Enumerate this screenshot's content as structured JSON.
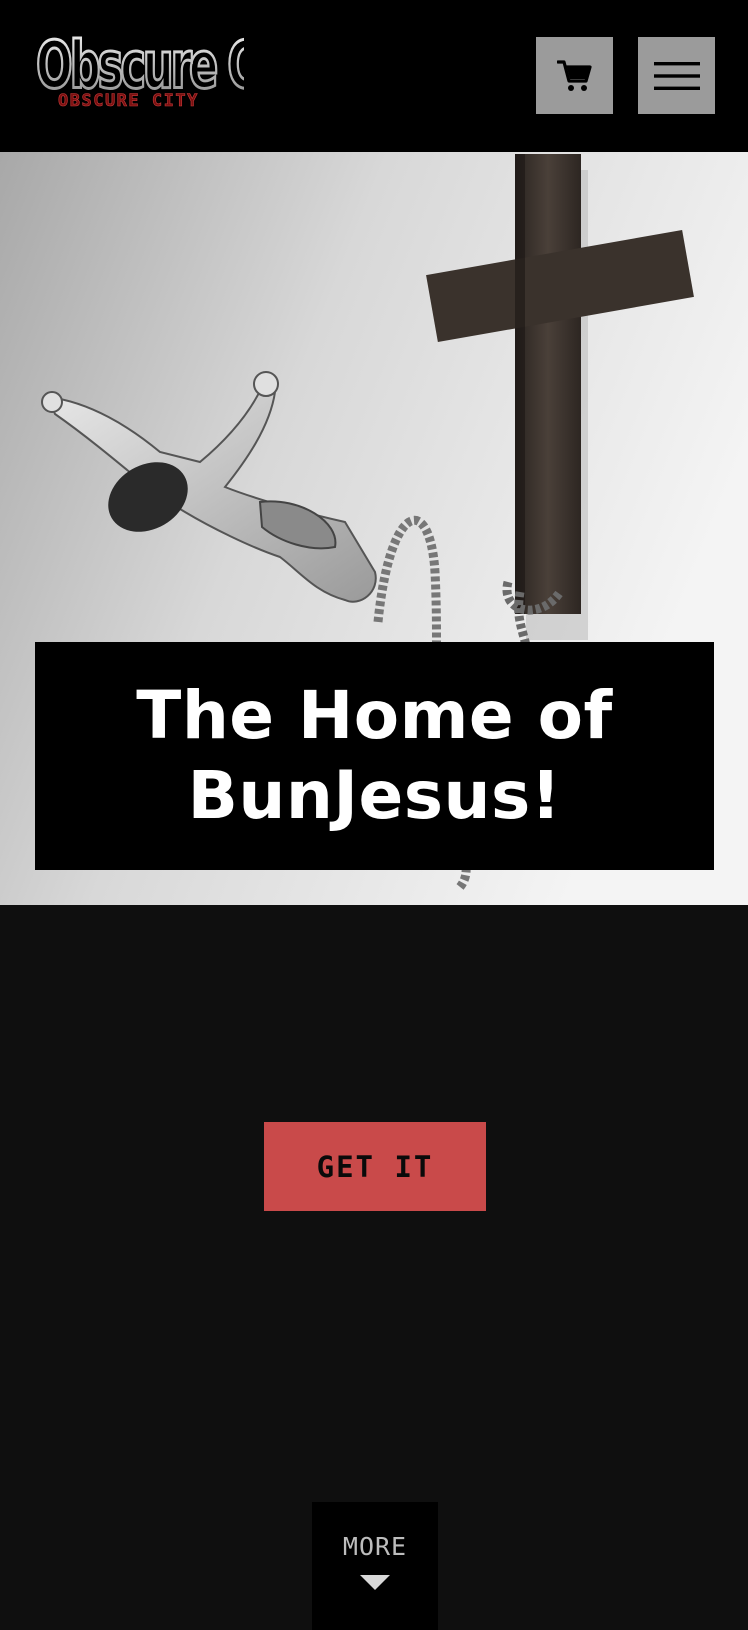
{
  "header": {
    "logo_text_main": "Obscure City",
    "logo_text_sub": "OBSCURE CITY",
    "cart_icon": "shopping-cart-icon",
    "menu_icon": "hamburger-menu-icon"
  },
  "hero": {
    "headline": "The Home of BunJesus!"
  },
  "cta": {
    "label": "GET IT"
  },
  "more": {
    "label": "MORE",
    "icon": "caret-down-icon"
  },
  "colors": {
    "header_bg": "#000000",
    "page_bg": "#0f0f0f",
    "icon_button_bg": "#9b9b9b",
    "cta_bg": "#c94a4a",
    "headline_box_bg": "#000000"
  }
}
